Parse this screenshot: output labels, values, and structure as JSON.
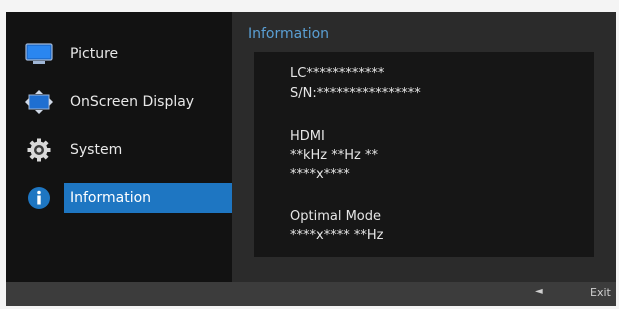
{
  "menu": {
    "items": [
      {
        "label": "Picture",
        "icon": "monitor-icon",
        "selected": false
      },
      {
        "label": "OnScreen Display",
        "icon": "osd-arrows-icon",
        "selected": false
      },
      {
        "label": "System",
        "icon": "gear-icon",
        "selected": false
      },
      {
        "label": "Information",
        "icon": "info-icon",
        "selected": true
      }
    ]
  },
  "panel": {
    "title": "Information",
    "lines": {
      "model": "LC************",
      "serial": "S/N:****************",
      "input": "HDMI",
      "frequency": "**kHz **Hz **",
      "resolution": "****x****",
      "optimal_label": "Optimal Mode",
      "optimal_value": "****x**** **Hz"
    }
  },
  "footer": {
    "left_arrow": "◄",
    "exit_label": "Exit"
  },
  "colors": {
    "accent": "#1e76c2",
    "title": "#5a9fd4",
    "panel_bg": "#2b2b2b",
    "menu_bg": "#121212"
  }
}
